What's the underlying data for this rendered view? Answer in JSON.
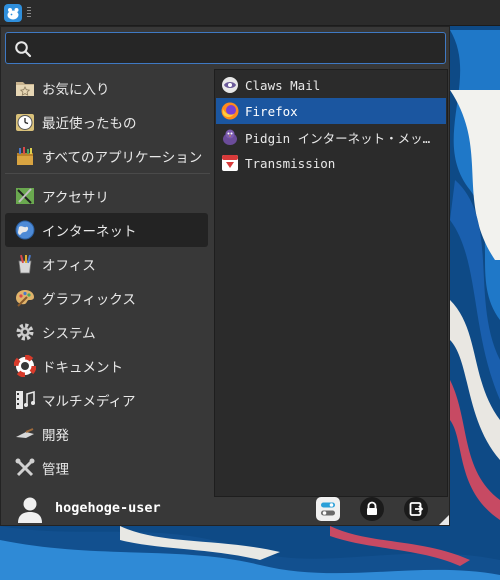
{
  "search": {
    "value": "",
    "placeholder": ""
  },
  "categories": [
    {
      "label": "お気に入り",
      "icon": "favorites-folder-icon"
    },
    {
      "label": "最近使ったもの",
      "icon": "recent-clock-icon"
    },
    {
      "label": "すべてのアプリケーション",
      "icon": "all-applications-icon"
    },
    {
      "label": "アクセサリ",
      "icon": "accessories-icon"
    },
    {
      "label": "インターネット",
      "icon": "internet-globe-icon",
      "selected": true
    },
    {
      "label": "オフィス",
      "icon": "office-icon"
    },
    {
      "label": "グラフィックス",
      "icon": "graphics-palette-icon"
    },
    {
      "label": "システム",
      "icon": "system-gear-icon"
    },
    {
      "label": "ドキュメント",
      "icon": "documents-lifebuoy-icon"
    },
    {
      "label": "マルチメディア",
      "icon": "multimedia-icon"
    },
    {
      "label": "開発",
      "icon": "development-trowel-icon"
    },
    {
      "label": "管理",
      "icon": "settings-tools-icon"
    }
  ],
  "apps": [
    {
      "label": "Claws Mail",
      "icon": "claws-mail-icon"
    },
    {
      "label": "Firefox",
      "icon": "firefox-icon",
      "selected": true
    },
    {
      "label": "Pidgin インターネット・メッ…",
      "icon": "pidgin-icon"
    },
    {
      "label": "Transmission",
      "icon": "transmission-icon"
    }
  ],
  "user": {
    "name": "hogehoge-user"
  },
  "colors": {
    "selection": "#1b56a0",
    "search_border": "#3f79c3",
    "menu_bg": "#383838",
    "pane_bg": "#2b2b2b"
  }
}
